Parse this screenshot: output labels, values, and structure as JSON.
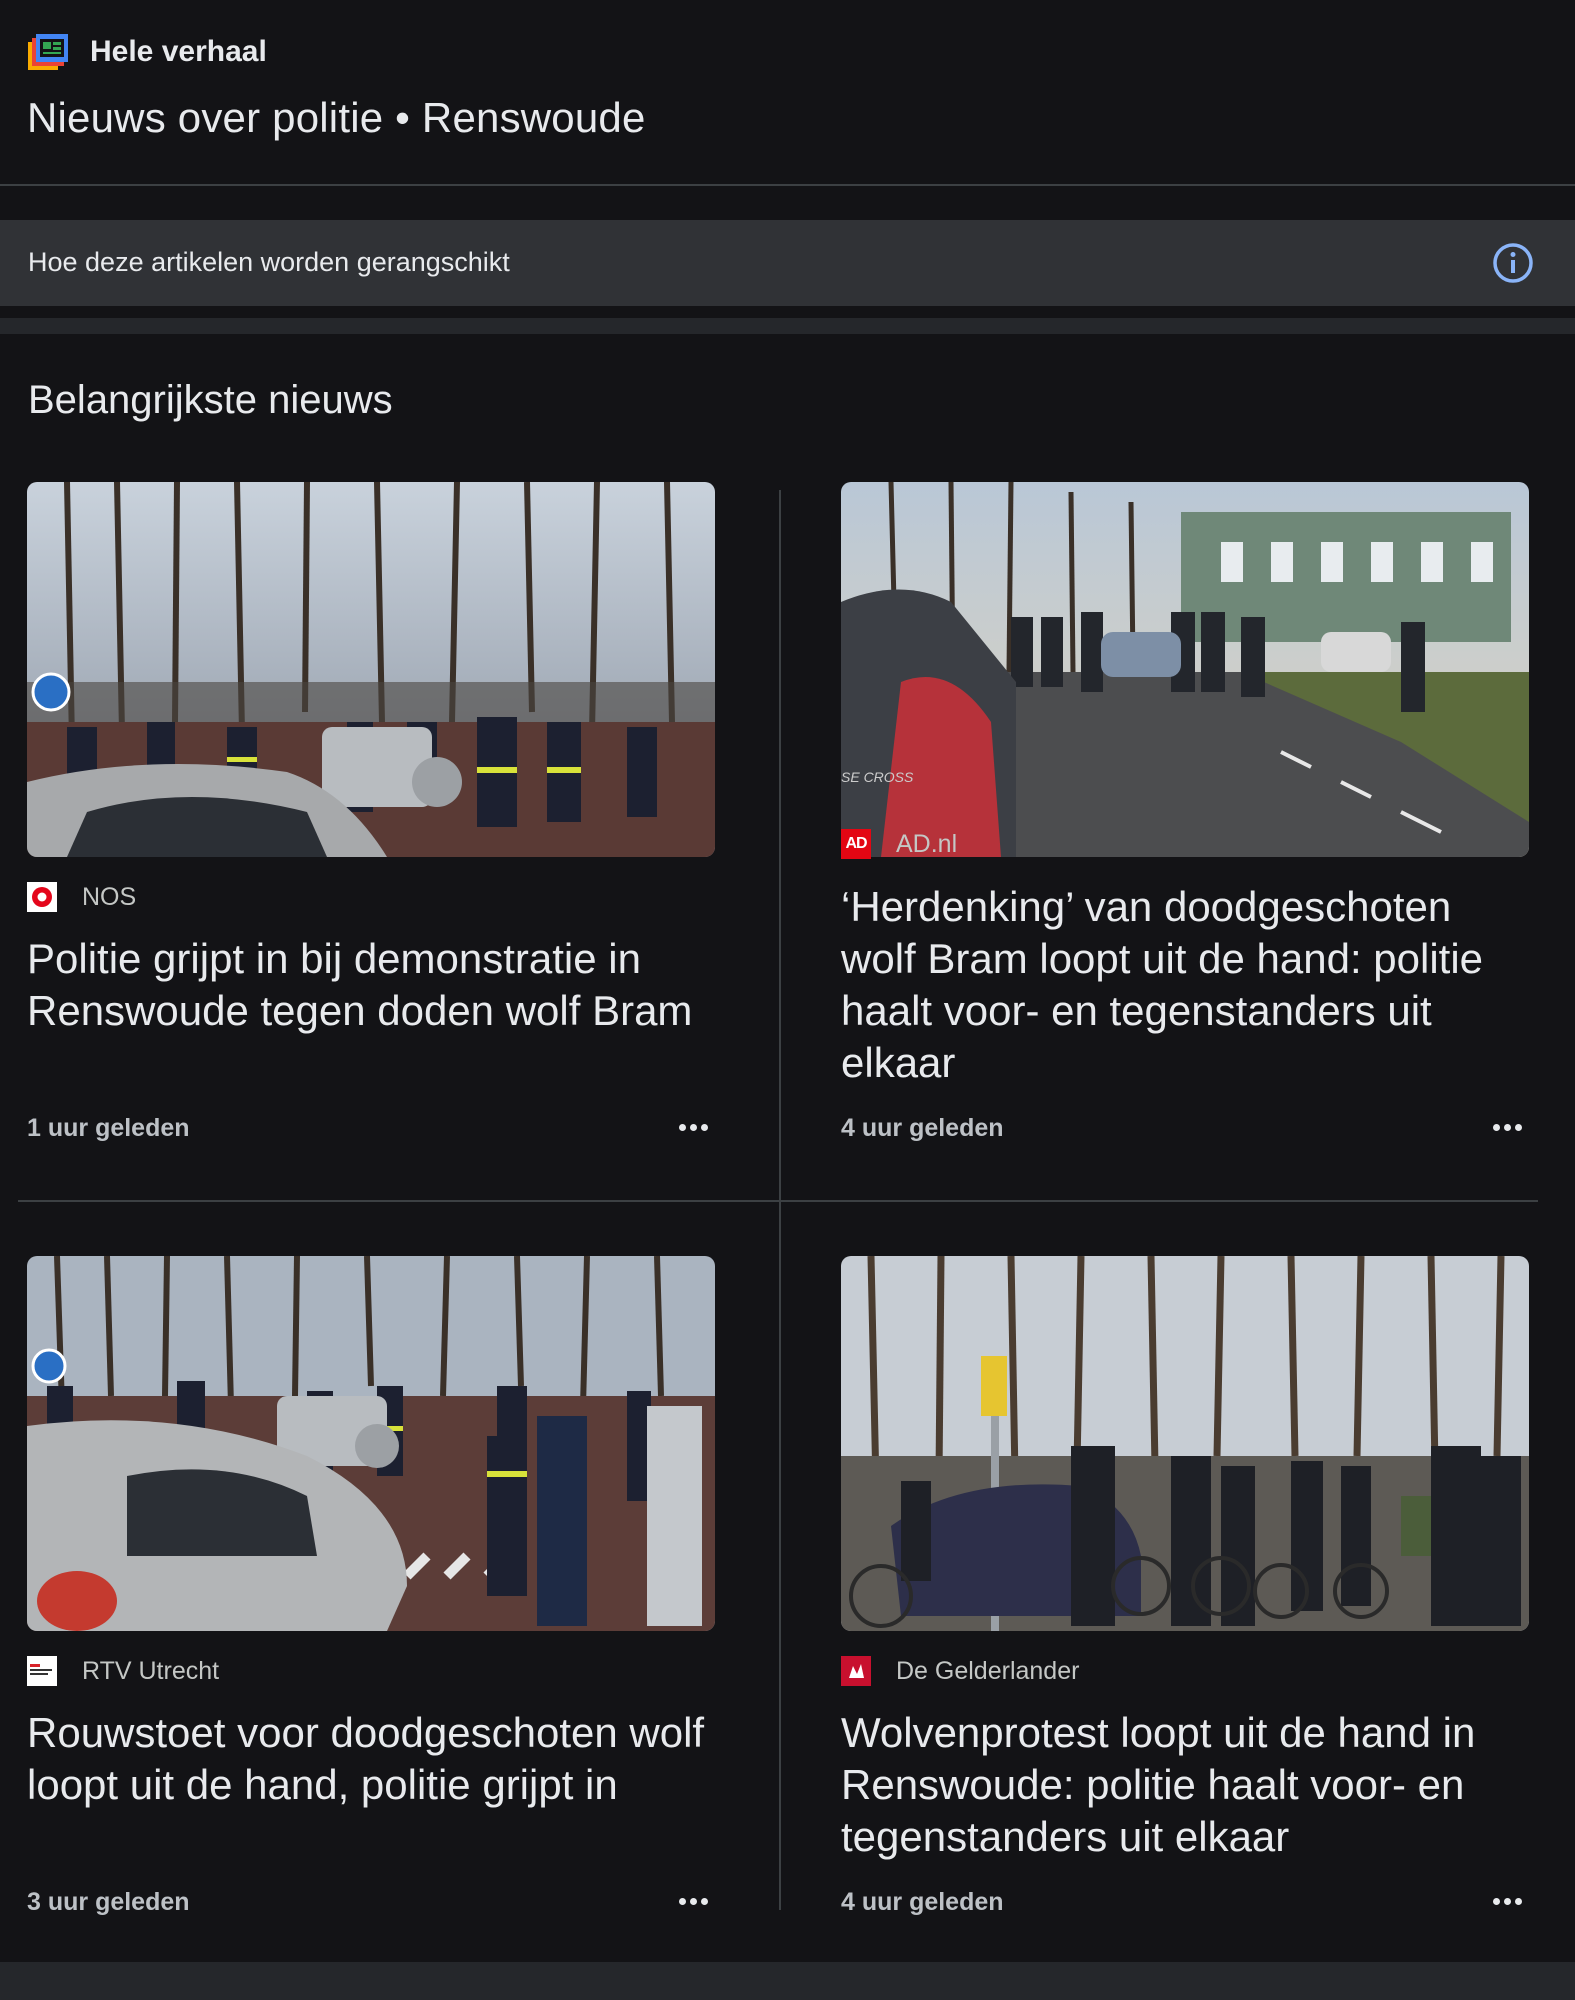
{
  "header": {
    "brand_label": "Hele verhaal",
    "brand_icon": "full-coverage-icon",
    "story_title": "Nieuws over politie • Renswoude"
  },
  "ranking": {
    "text": "Hoe deze artikelen worden gerangschikt",
    "icon": "info-icon"
  },
  "section": {
    "title": "Belangrijkste nieuws"
  },
  "articles": [
    {
      "source": "NOS",
      "source_logo": "nos-logo",
      "headline": "Politie grijpt in bij demonstratie in Renswoude tegen doden wolf Bram",
      "time": "1 uur geleden"
    },
    {
      "source": "AD.nl",
      "source_logo": "ad-logo",
      "logo_text": "AD",
      "headline": "‘Herdenking’ van doodgeschoten wolf Bram loopt uit de hand: politie haalt voor- en tegenstan­ders uit elkaar",
      "time": "4 uur geleden"
    },
    {
      "source": "RTV Utrecht",
      "source_logo": "rtv-utrecht-logo",
      "headline": "Rouwstoet voor doodgeschoten wolf loopt uit de hand, politie grijpt in",
      "time": "3 uur geleden"
    },
    {
      "source": "De Gelderlander",
      "source_logo": "gelderlander-logo",
      "headline": "Wolvenprotest loopt uit de hand in Renswoude: politie haalt voor- en tegenstanders uit elkaar",
      "time": "4 uur geleden"
    }
  ],
  "colors": {
    "background": "#131316",
    "ranking_bar": "#303236",
    "text_primary": "#e8eaed",
    "text_secondary": "#bdc1c6",
    "info_icon": "#8ab4f8"
  }
}
